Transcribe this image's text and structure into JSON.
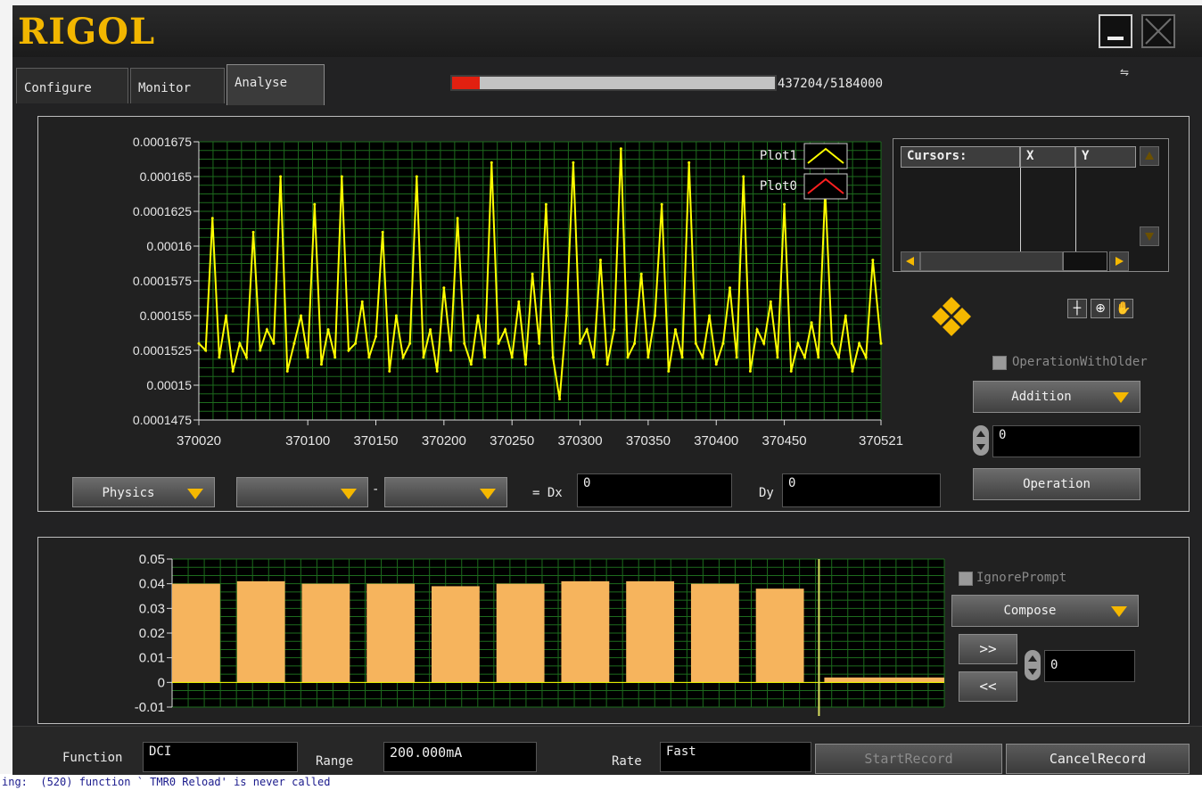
{
  "window": {
    "logo": "RIGOL"
  },
  "tabs": [
    {
      "label": "Configure",
      "active": false
    },
    {
      "label": "Monitor",
      "active": false
    },
    {
      "label": "Analyse",
      "active": true
    }
  ],
  "progress": {
    "text": "437204/5184000",
    "fraction": 0.0843
  },
  "colors": {
    "accent": "#f5b800",
    "plot1": "#ffff00",
    "plot0": "#ff2020",
    "bars": "#f6b45d",
    "grid": "#1d6b1d",
    "plot_bg": "#000000"
  },
  "chart_data": [
    {
      "type": "line",
      "legend": [
        "Plot1",
        "Plot0"
      ],
      "x_ticks": [
        "370020",
        "370100",
        "370150",
        "370200",
        "370250",
        "370300",
        "370350",
        "370400",
        "370450",
        "370521"
      ],
      "x_tick_values": [
        370020,
        370100,
        370150,
        370200,
        370250,
        370300,
        370350,
        370400,
        370450,
        370521
      ],
      "y_ticks": [
        "0.0001675",
        "0.000165",
        "0.0001625",
        "0.00016",
        "0.0001575",
        "0.000155",
        "0.0001525",
        "0.00015",
        "0.0001475"
      ],
      "xlim": [
        370020,
        370521
      ],
      "ylim": [
        0.0001475,
        0.0001675
      ],
      "grid": true,
      "legend_position": "top-right",
      "series": [
        {
          "name": "Plot1",
          "x": [
            370020,
            370025,
            370030,
            370035,
            370040,
            370045,
            370050,
            370055,
            370060,
            370065,
            370070,
            370075,
            370080,
            370085,
            370090,
            370095,
            370100,
            370105,
            370110,
            370115,
            370120,
            370125,
            370130,
            370135,
            370140,
            370145,
            370150,
            370155,
            370160,
            370165,
            370170,
            370175,
            370180,
            370185,
            370190,
            370195,
            370200,
            370205,
            370210,
            370215,
            370220,
            370225,
            370230,
            370235,
            370240,
            370245,
            370250,
            370255,
            370260,
            370265,
            370270,
            370275,
            370280,
            370285,
            370290,
            370295,
            370300,
            370305,
            370310,
            370315,
            370320,
            370325,
            370330,
            370335,
            370340,
            370345,
            370350,
            370355,
            370360,
            370365,
            370370,
            370375,
            370380,
            370385,
            370390,
            370395,
            370400,
            370405,
            370410,
            370415,
            370420,
            370425,
            370430,
            370435,
            370440,
            370445,
            370450,
            370455,
            370460,
            370465,
            370470,
            370475,
            370480,
            370485,
            370490,
            370495,
            370500,
            370505,
            370510,
            370515,
            370521
          ],
          "values": [
            0.000153,
            0.0001525,
            0.000162,
            0.000152,
            0.000155,
            0.000151,
            0.000153,
            0.000152,
            0.000161,
            0.0001525,
            0.000154,
            0.000153,
            0.000165,
            0.000151,
            0.000153,
            0.000155,
            0.000152,
            0.000163,
            0.0001515,
            0.000154,
            0.000152,
            0.000165,
            0.0001525,
            0.000153,
            0.000156,
            0.000152,
            0.0001535,
            0.000161,
            0.000151,
            0.000155,
            0.000152,
            0.000153,
            0.000165,
            0.000152,
            0.000154,
            0.000151,
            0.000157,
            0.0001525,
            0.000162,
            0.000153,
            0.0001515,
            0.000155,
            0.000152,
            0.000166,
            0.000153,
            0.000154,
            0.000152,
            0.000156,
            0.0001515,
            0.000158,
            0.000153,
            0.000163,
            0.000152,
            0.000149,
            0.000155,
            0.000166,
            0.000153,
            0.000154,
            0.000152,
            0.000159,
            0.0001515,
            0.000154,
            0.000167,
            0.000152,
            0.000153,
            0.000158,
            0.000152,
            0.000155,
            0.000163,
            0.000151,
            0.000154,
            0.000152,
            0.000166,
            0.000153,
            0.000152,
            0.000155,
            0.0001515,
            0.000153,
            0.000157,
            0.000152,
            0.000165,
            0.000151,
            0.000154,
            0.000153,
            0.000156,
            0.000152,
            0.000163,
            0.000151,
            0.000153,
            0.000152,
            0.0001545,
            0.000152,
            0.000164,
            0.000153,
            0.000152,
            0.000155,
            0.000151,
            0.000153,
            0.000152,
            0.000159,
            0.000153
          ]
        }
      ]
    },
    {
      "type": "bar",
      "y_ticks": [
        "0.05",
        "0.04",
        "0.03",
        "0.02",
        "0.01",
        "0",
        "-0.01"
      ],
      "ylim": [
        -0.01,
        0.05
      ],
      "grid": true,
      "bursts": [
        0.04,
        0.041,
        0.04,
        0.04,
        0.039,
        0.04,
        0.041,
        0.041,
        0.04,
        0.038
      ],
      "tail_level": 0.002,
      "marker": 0.05
    }
  ],
  "cursors": {
    "header": "Cursors:",
    "col_x": "X",
    "col_y": "Y"
  },
  "analysis": {
    "operation_with_older": "OperationWithOlder",
    "addition": "Addition",
    "operand_value": "0",
    "operation_button": "Operation",
    "physics": "Physics",
    "source_a": "",
    "minus": "-",
    "dx_label": "= Dx",
    "dx_value": "0",
    "dy_label": "Dy",
    "dy_value": "0"
  },
  "compose_panel": {
    "ignore_prompt": "IgnorePrompt",
    "compose": "Compose",
    "forward": ">>",
    "back": "<<",
    "step_value": "0"
  },
  "bottom": {
    "function_label": "Function",
    "function_value": "DCI",
    "range_label": "Range",
    "range_value": "200.000mA",
    "rate_label": "Rate",
    "rate_value": "Fast",
    "start_record": "StartRecord",
    "cancel_record": "CancelRecord"
  },
  "background_text": "ing:  (520) function ` TMR0 Reload' is never called"
}
